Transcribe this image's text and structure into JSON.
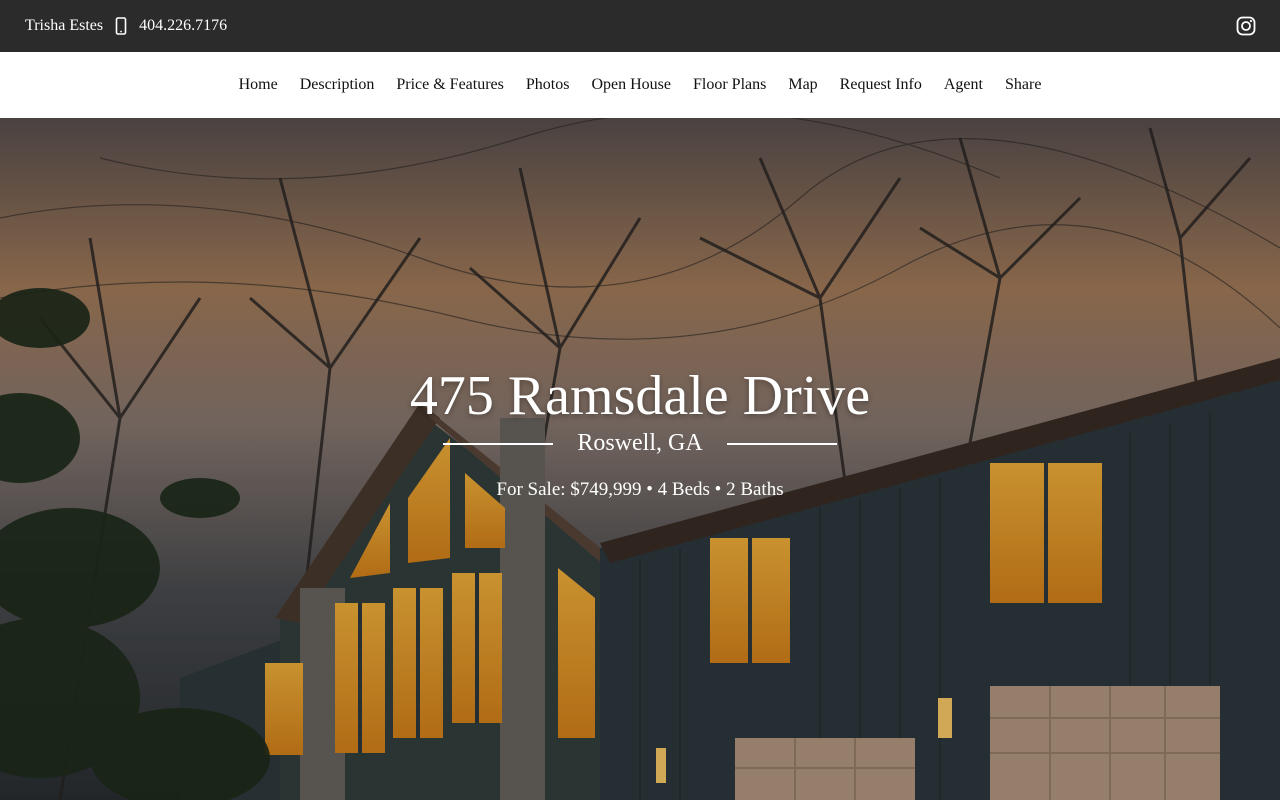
{
  "agent": {
    "name": "Trisha Estes",
    "phone": "404.226.7176"
  },
  "icons": {
    "phone": "mobile-phone-icon",
    "social": "instagram-icon"
  },
  "nav": {
    "items": [
      {
        "label": "Home"
      },
      {
        "label": "Description"
      },
      {
        "label": "Price & Features"
      },
      {
        "label": "Photos"
      },
      {
        "label": "Open House"
      },
      {
        "label": "Floor Plans"
      },
      {
        "label": "Map"
      },
      {
        "label": "Request Info"
      },
      {
        "label": "Agent"
      },
      {
        "label": "Share"
      }
    ]
  },
  "hero": {
    "address": "475 Ramsdale Drive",
    "city": "Roswell, GA",
    "details": "For Sale: $749,999 • 4 Beds • 2 Baths"
  },
  "colors": {
    "topbar": "#2b2b2b",
    "nav_bg": "#ffffff",
    "text_light": "#ffffff"
  }
}
